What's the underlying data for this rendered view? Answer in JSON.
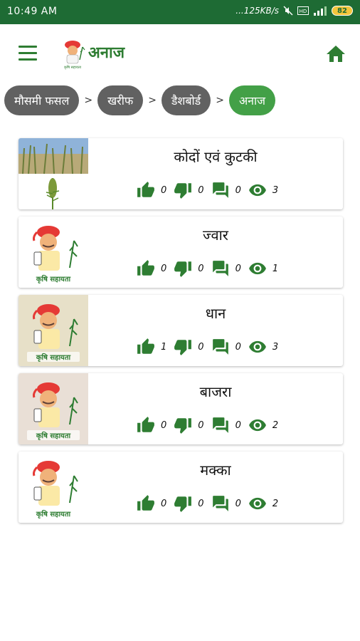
{
  "status_bar": {
    "time": "10:49 AM",
    "speed": "...125KB/s",
    "battery": "82",
    "icons": [
      "mute-icon",
      "volte-icon",
      "signal-icon",
      "battery-icon"
    ]
  },
  "header": {
    "title": "अनाज",
    "logo_text": "कृषि सहायता",
    "icons": [
      "menu-icon",
      "home-icon"
    ]
  },
  "breadcrumb": {
    "separator": ">",
    "items": [
      {
        "label": "मौसमी फसल",
        "active": false
      },
      {
        "label": "खरीफ",
        "active": false
      },
      {
        "label": "डैशबोर्ड",
        "active": false
      },
      {
        "label": "अनाज",
        "active": true
      }
    ]
  },
  "crops": [
    {
      "name": "कोदों एवं कुटकी",
      "likes": "0",
      "dislikes": "0",
      "comments": "0",
      "views": "3",
      "image": "millet-field-photo"
    },
    {
      "name": "ज्वार",
      "likes": "0",
      "dislikes": "0",
      "comments": "0",
      "views": "1",
      "image": "krishi-sahayata-farmer"
    },
    {
      "name": "धान",
      "likes": "1",
      "dislikes": "0",
      "comments": "0",
      "views": "3",
      "image": "krishi-sahayata-farmer-paddy"
    },
    {
      "name": "बाजरा",
      "likes": "0",
      "dislikes": "0",
      "comments": "0",
      "views": "2",
      "image": "krishi-sahayata-farmer-grain"
    },
    {
      "name": "मक्का",
      "likes": "0",
      "dislikes": "0",
      "comments": "0",
      "views": "2",
      "image": "krishi-sahayata-farmer"
    }
  ],
  "colors": {
    "status_bar": "#1e6b34",
    "accent": "#2e7d32",
    "active_crumb": "#43a047",
    "inactive_crumb": "#616161"
  }
}
